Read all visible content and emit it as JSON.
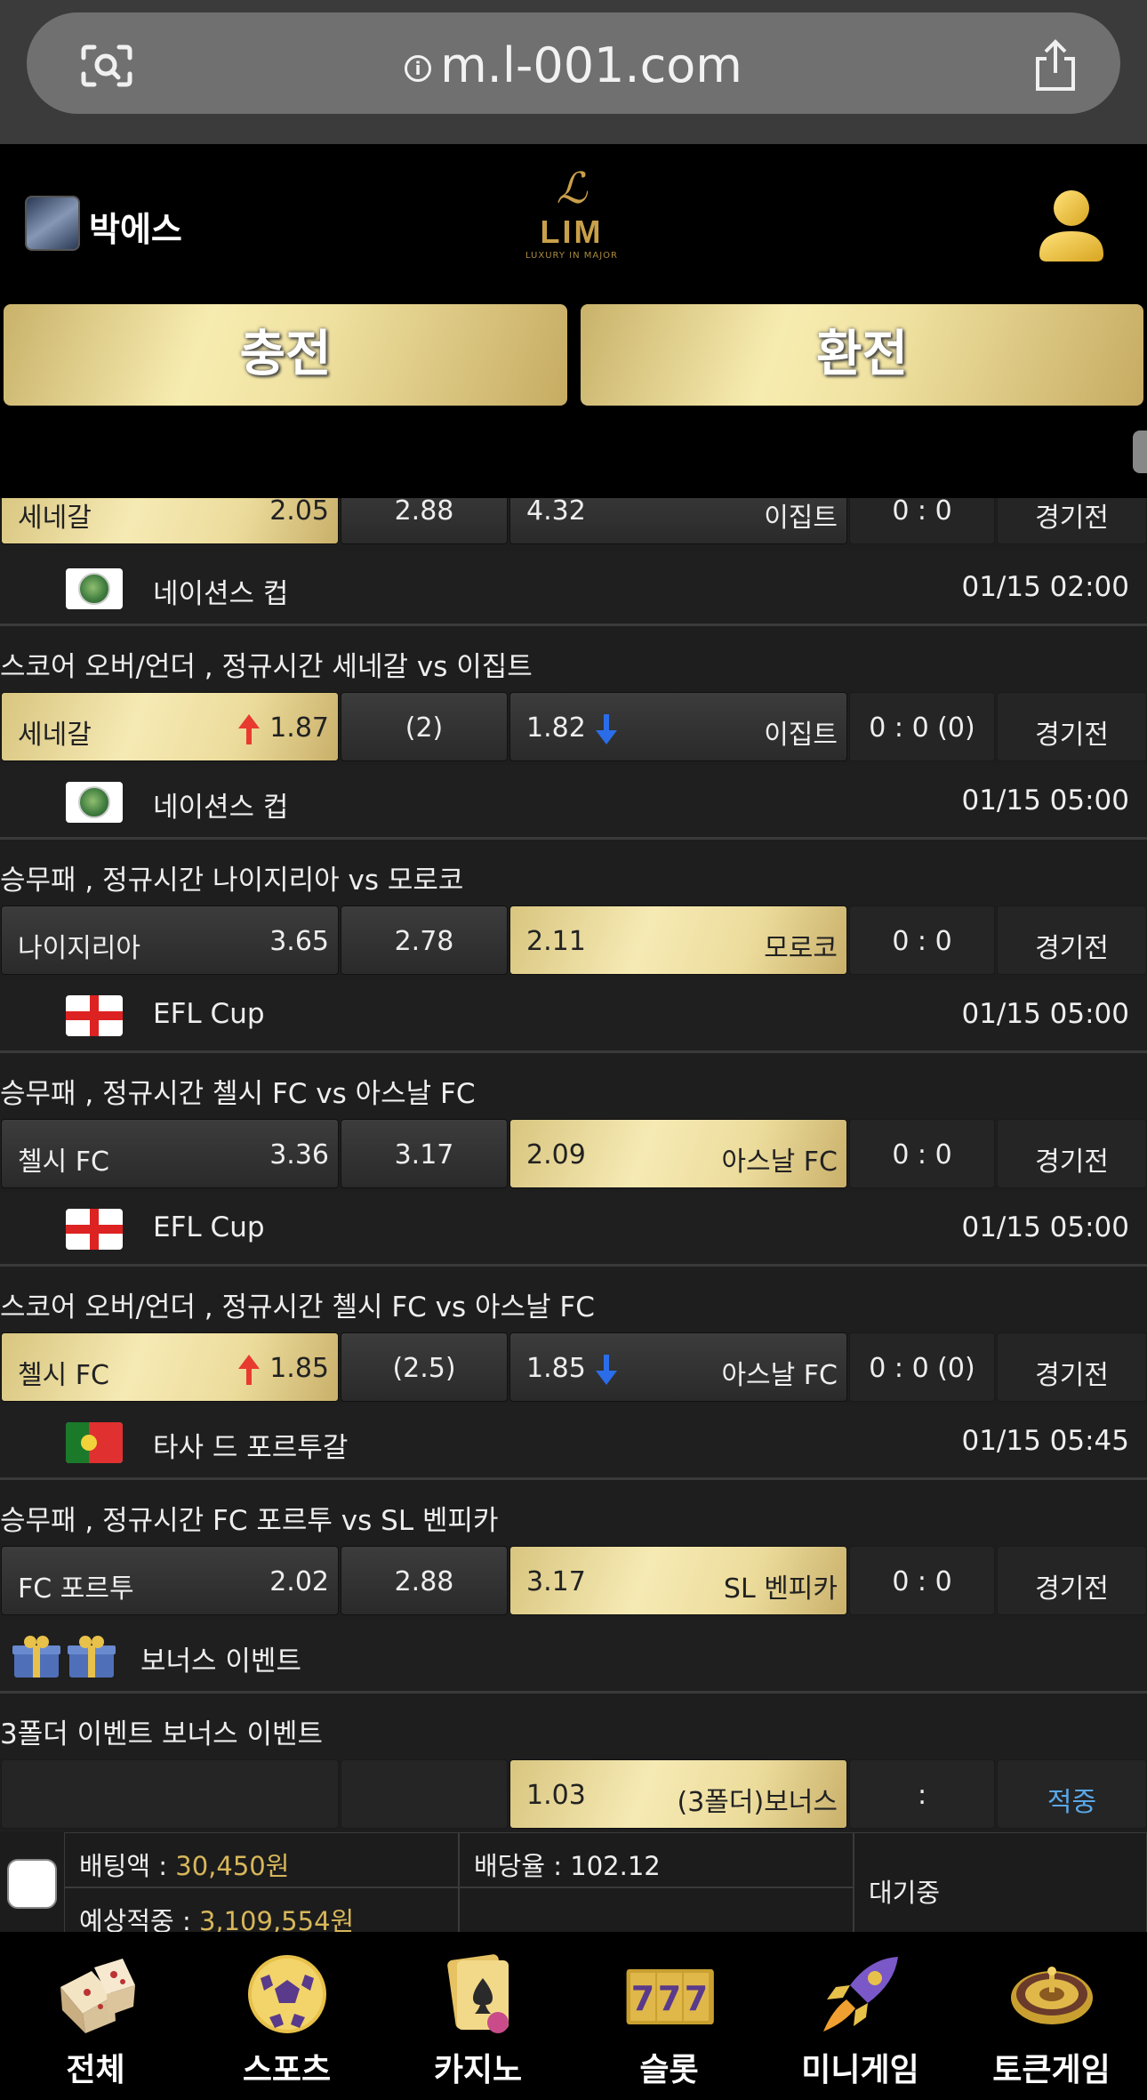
{
  "browser": {
    "url": "m.l-001.com"
  },
  "header": {
    "username": "박에스",
    "logo_text": "LIM",
    "logo_sub": "LUXURY IN MAJOR",
    "charge_label": "충전",
    "exchange_label": "환전"
  },
  "rows": {
    "r0": {
      "home": "세네갈",
      "home_odds": "2.05",
      "draw": "2.88",
      "away_odds": "4.32",
      "away": "이집트",
      "score": "0 : 0",
      "status": "경기전"
    },
    "l1": {
      "league": "네이션스 컵",
      "time": "01/15 02:00"
    },
    "t1": "스코어 오버/언더 , 정규시간 세네갈  vs  이집트",
    "r1": {
      "home": "세네갈",
      "home_odds": "1.87",
      "draw": "(2)",
      "away_odds": "1.82",
      "away": "이집트",
      "score": "0 : 0 (0)",
      "status": "경기전"
    },
    "l2": {
      "league": "네이션스 컵",
      "time": "01/15 05:00"
    },
    "t2": "승무패 , 정규시간 나이지리아  vs  모로코",
    "r2": {
      "home": "나이지리아",
      "home_odds": "3.65",
      "draw": "2.78",
      "away_odds": "2.11",
      "away": "모로코",
      "score": "0 : 0",
      "status": "경기전"
    },
    "l3": {
      "league": "EFL Cup",
      "time": "01/15 05:00"
    },
    "t3": "승무패 , 정규시간 첼시 FC  vs  아스날 FC",
    "r3": {
      "home": "첼시 FC",
      "home_odds": "3.36",
      "draw": "3.17",
      "away_odds": "2.09",
      "away": "아스날 FC",
      "score": "0 : 0",
      "status": "경기전"
    },
    "l4": {
      "league": "EFL Cup",
      "time": "01/15 05:00"
    },
    "t4": "스코어 오버/언더 , 정규시간 첼시 FC  vs  아스날 FC",
    "r4": {
      "home": "첼시 FC",
      "home_odds": "1.85",
      "draw": "(2.5)",
      "away_odds": "1.85",
      "away": "아스날 FC",
      "score": "0 : 0 (0)",
      "status": "경기전"
    },
    "l5": {
      "league": "타사 드 포르투갈",
      "time": "01/15 05:45"
    },
    "t5": "승무패 , 정규시간 FC 포르투  vs  SL 벤피카",
    "r5": {
      "home": "FC 포르투",
      "home_odds": "2.02",
      "draw": "2.88",
      "away_odds": "3.17",
      "away": "SL 벤피카",
      "score": "0 : 0",
      "status": "경기전"
    },
    "l6": {
      "league": "보너스 이벤트"
    },
    "t6": "3폴더 이벤트 보너스 이벤트",
    "r6": {
      "away_odds": "1.03",
      "away": "(3폴더)보너스",
      "score": ":",
      "status": "적중"
    }
  },
  "slip": {
    "bet_label": "배팅액 : ",
    "bet_value": "30,450원",
    "rate_label": "배당율 : 102.12",
    "expected_label": "예상적중 : ",
    "expected_value": "3,109,554원",
    "state": "대기중"
  },
  "nav": [
    {
      "label": "전체",
      "icon": "dice-icon"
    },
    {
      "label": "스포츠",
      "icon": "soccer-ball-icon"
    },
    {
      "label": "카지노",
      "icon": "cards-icon"
    },
    {
      "label": "슬롯",
      "icon": "slot-777-icon"
    },
    {
      "label": "미니게임",
      "icon": "rocket-icon"
    },
    {
      "label": "토큰게임",
      "icon": "roulette-icon"
    }
  ],
  "colors": {
    "gold": "#e9d893",
    "up_arrow": "#e83b2f",
    "down_arrow": "#2b6de8",
    "win": "#5aa8e8"
  }
}
